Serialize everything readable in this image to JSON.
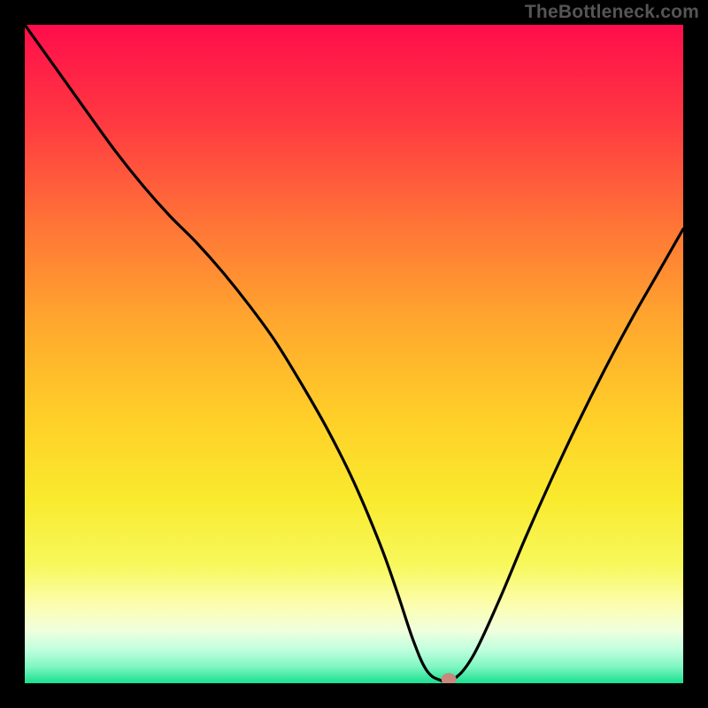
{
  "watermark": "TheBottleneck.com",
  "chart_data": {
    "type": "line",
    "title": "",
    "xlabel": "",
    "ylabel": "",
    "xlim": [
      0,
      100
    ],
    "ylim": [
      0,
      100
    ],
    "grid": false,
    "curve": {
      "name": "bottleneck-curve",
      "x": [
        0,
        5,
        10,
        14,
        18,
        22,
        26,
        30,
        34,
        38,
        42,
        46,
        50,
        54,
        56.5,
        59,
        61,
        63,
        65,
        68,
        72,
        76,
        80,
        84,
        88,
        92,
        96,
        100
      ],
      "y": [
        100,
        93,
        86,
        80.5,
        75.5,
        71,
        67,
        62.5,
        57.5,
        52,
        45.5,
        38.5,
        30.5,
        21,
        14,
        6.5,
        2,
        0.5,
        0.5,
        4,
        12.5,
        22,
        31,
        39.5,
        47.5,
        55,
        62,
        69
      ]
    },
    "marker": {
      "name": "optimal-point",
      "x": 64.4,
      "y": 0.6,
      "color": "#c7897c"
    },
    "background": {
      "type": "vertical-gradient",
      "stops": [
        {
          "y": 100,
          "color": "#ff0d4b"
        },
        {
          "y": 85,
          "color": "#ff3a41"
        },
        {
          "y": 70,
          "color": "#ff7337"
        },
        {
          "y": 55,
          "color": "#ffa72e"
        },
        {
          "y": 40,
          "color": "#ffd028"
        },
        {
          "y": 28,
          "color": "#f9ea2e"
        },
        {
          "y": 18,
          "color": "#f8f85c"
        },
        {
          "y": 12,
          "color": "#fcfdad"
        },
        {
          "y": 8,
          "color": "#f0ffde"
        },
        {
          "y": 5,
          "color": "#beffde"
        },
        {
          "y": 2.5,
          "color": "#7ff6c2"
        },
        {
          "y": 0,
          "color": "#18e08f"
        }
      ]
    }
  }
}
